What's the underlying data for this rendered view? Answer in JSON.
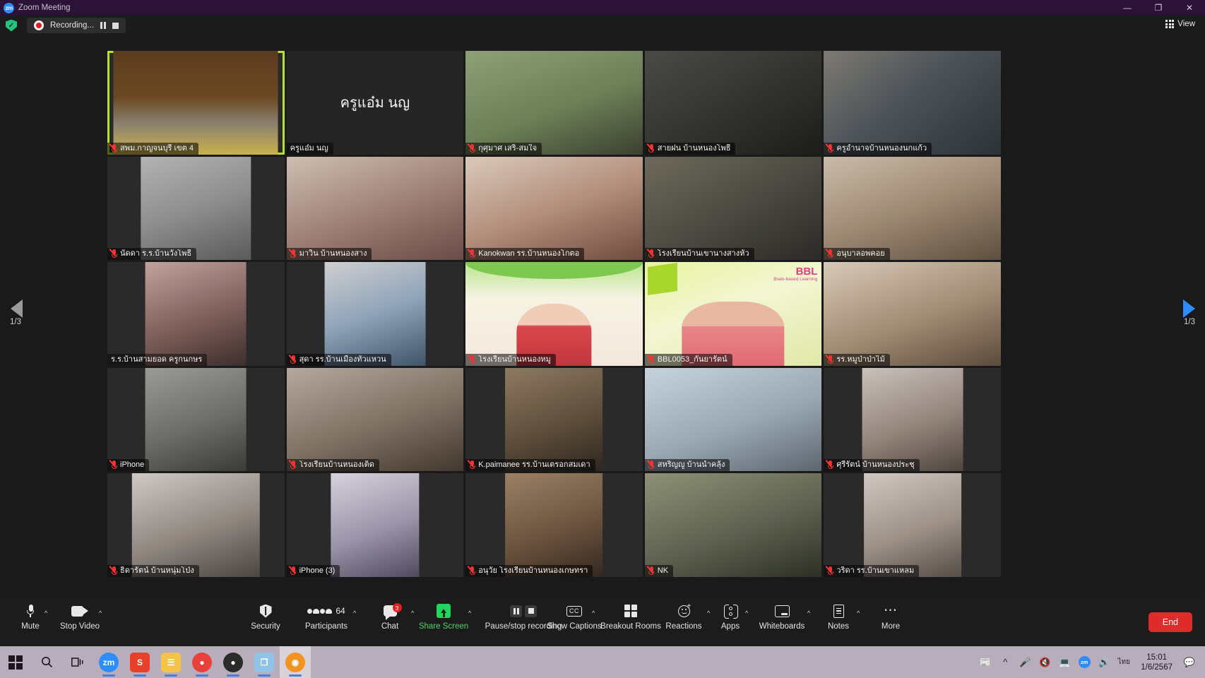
{
  "titlebar": {
    "app_title": "Zoom Meeting",
    "logo_text": "zm",
    "minimize": "—",
    "maximize": "❐",
    "close": "✕"
  },
  "recording_bar": {
    "status_text": "Recording...",
    "pause_label": "Pause recording",
    "stop_label": "Stop recording",
    "view_label": "View"
  },
  "gallery": {
    "page_left": "1/3",
    "page_right": "1/3",
    "active_tile_index": 0,
    "participants": [
      {
        "name": "สพม.กาญจนบุรี เขต 4",
        "muted": true,
        "video": true,
        "active": true,
        "theme": "meetingroom"
      },
      {
        "name": "ครูแอ๋ม นญ",
        "muted": false,
        "video": false,
        "big_name": "ครูแอ๋ม นญ",
        "theme": "novideo"
      },
      {
        "name": "กุศุมาศ เสริ-สมใจ",
        "muted": true,
        "video": true,
        "theme": "g1"
      },
      {
        "name": "สายฝน บ้านหนองโพธิ์",
        "muted": true,
        "video": true,
        "theme": "g2"
      },
      {
        "name": "ครูอำนาจบ้านหนองนกแก้ว",
        "muted": true,
        "video": true,
        "theme": "g3"
      },
      {
        "name": "นัดดา ร.ร.บ้านวังโพธิ์",
        "muted": true,
        "video": true,
        "theme": "g4"
      },
      {
        "name": "มาวิน บ้านหนองสาง",
        "muted": true,
        "video": true,
        "theme": "g5"
      },
      {
        "name": "Kanokwan รร.บ้านหนองโกตอ",
        "muted": true,
        "video": true,
        "theme": "g6"
      },
      {
        "name": "โรงเรียนบ้านเขานางสางหัว",
        "muted": true,
        "video": true,
        "theme": "g7"
      },
      {
        "name": "อนุบาลอพคอย",
        "muted": true,
        "video": true,
        "theme": "g8"
      },
      {
        "name": "ร.ร.บ้านสามยอด ครูกนกษร",
        "muted": false,
        "video": true,
        "theme": "g9"
      },
      {
        "name": "สุดา  รร.บ้านเมืองทั่วแหวน",
        "muted": true,
        "video": true,
        "theme": "g10"
      },
      {
        "name": "โรงเรียนบ้านหนองหมู",
        "muted": true,
        "video": true,
        "theme": "g11"
      },
      {
        "name": "BBL0053_กันยารัตน์",
        "muted": true,
        "video": true,
        "theme": "bbl"
      },
      {
        "name": "รร.หมูป่าป่าไม้",
        "muted": true,
        "video": true,
        "theme": "g12"
      },
      {
        "name": "iPhone",
        "muted": true,
        "video": true,
        "theme": "g13"
      },
      {
        "name": "โรงเรียนบ้านหนองเต็ด",
        "muted": true,
        "video": true,
        "theme": "g14"
      },
      {
        "name": "K.paimanee รร.บ้านเตรอกสมเดา",
        "muted": true,
        "video": true,
        "theme": "g15"
      },
      {
        "name": "สหริญญู บ้านน้ำคลุ้ง",
        "muted": true,
        "video": true,
        "theme": "g16"
      },
      {
        "name": "ศุรีรัตน์ บ้านหนองประชุ",
        "muted": true,
        "video": true,
        "theme": "g17"
      },
      {
        "name": "ธิดารัตน์ บ้านหนุ่มโป่ง",
        "muted": true,
        "video": true,
        "theme": "g18"
      },
      {
        "name": "iPhone (3)",
        "muted": true,
        "video": true,
        "theme": "g19"
      },
      {
        "name": "อนุวัย โรงเรียนบ้านหนองเกษทรา",
        "muted": true,
        "video": true,
        "theme": "g20"
      },
      {
        "name": "NK",
        "muted": true,
        "video": true,
        "theme": "g21"
      },
      {
        "name": "วริดา รร.บ้านเขาแหลม",
        "muted": true,
        "video": true,
        "theme": "g22"
      }
    ]
  },
  "bbl_card": {
    "title": "BBL",
    "subtitle": "Brain-based Learning"
  },
  "toolbar": {
    "mute_label": "Mute",
    "video_label": "Stop Video",
    "security_label": "Security",
    "participants_label": "Participants",
    "participants_count": "64",
    "chat_label": "Chat",
    "chat_badge": "3",
    "share_label": "Share Screen",
    "recording_label": "Pause/stop recording",
    "captions_label": "Show Captions",
    "rooms_label": "Breakout Rooms",
    "reactions_label": "Reactions",
    "apps_label": "Apps",
    "whiteboards_label": "Whiteboards",
    "notes_label": "Notes",
    "more_label": "More",
    "end_label": "End"
  },
  "taskbar": {
    "start_label": "Start",
    "search_label": "Search",
    "taskview_label": "Task View",
    "apps": [
      {
        "name": "zoom",
        "glyph": "zm",
        "color": "#2d8cff",
        "running": true
      },
      {
        "name": "snagit",
        "glyph": "S",
        "color": "#e8402a",
        "running": true
      },
      {
        "name": "file-explorer",
        "glyph": "☰",
        "color": "#f4c44a",
        "running": true
      },
      {
        "name": "chrome",
        "glyph": "●",
        "color": "#e8403a",
        "running": true
      },
      {
        "name": "media-player",
        "glyph": "●",
        "color": "#2b2b2b",
        "running": true
      },
      {
        "name": "photos",
        "glyph": "❒",
        "color": "#8fc4e8",
        "running": true
      },
      {
        "name": "obs-studio",
        "glyph": "◉",
        "color": "#f39422",
        "running": true,
        "selected": true
      }
    ],
    "tray_icons": [
      "news-icon",
      "show-hidden-icon",
      "mic-icon",
      "volume-mute-icon",
      "network-icon",
      "zoom-tray-icon",
      "speaker-icon",
      "language-icon"
    ],
    "language": "ไทย",
    "clock_time": "15:01",
    "clock_date": "1/6/2567",
    "notification_label": "Notifications"
  }
}
